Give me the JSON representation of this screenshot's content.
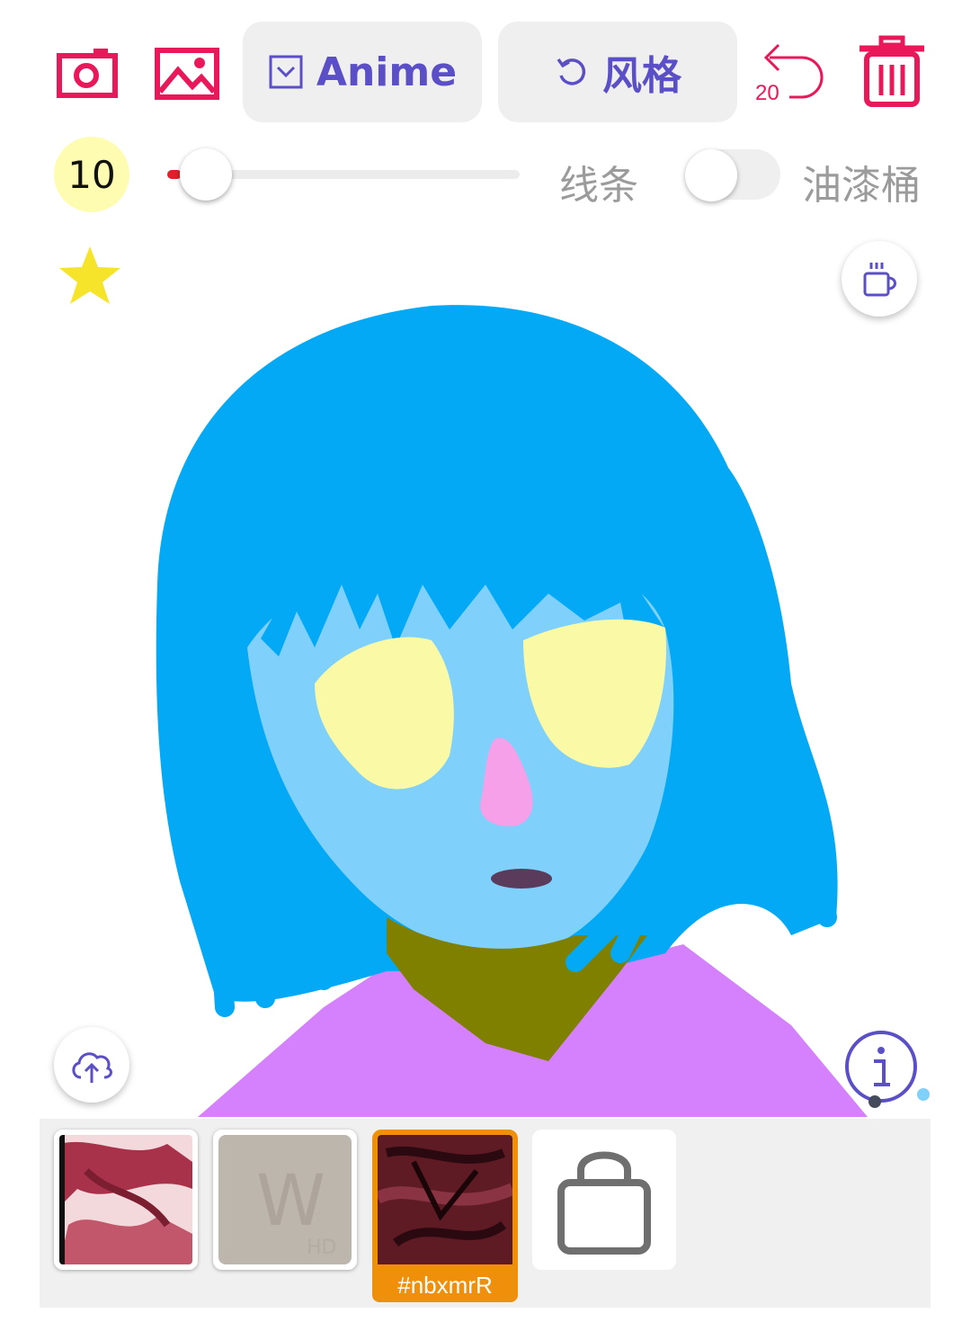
{
  "toolbar": {
    "camera_icon": "camera-icon",
    "gallery_icon": "image-icon",
    "model_button_label": "Anime",
    "style_button_label": "风格",
    "undo_count": "20",
    "trash_icon": "trash-icon"
  },
  "brush": {
    "size": "10",
    "size_fraction": 0.1,
    "line_label": "线条",
    "bucket_label": "油漆桶",
    "bucket_enabled": false
  },
  "side_buttons": {
    "favorite_icon": "star-icon",
    "coffee_icon": "coffee-cup-icon",
    "upload_icon": "cloud-upload-icon",
    "info_icon": "info-icon"
  },
  "gallery": {
    "items": [
      {
        "name": "style-thumb-1"
      },
      {
        "name": "style-thumb-2"
      },
      {
        "name": "style-thumb-3",
        "tag": "#nbxmrR",
        "selected": true
      },
      {
        "name": "shop-bag"
      }
    ]
  },
  "colors": {
    "accent_red": "#e8185a",
    "accent_purple": "#5b4fc8",
    "hair": "#03a9f4",
    "skin": "#7fd0fb",
    "eyes": "#fafaa6",
    "shirt": "#d580fd",
    "scarf": "#808000",
    "tag_orange": "#f0900a"
  }
}
